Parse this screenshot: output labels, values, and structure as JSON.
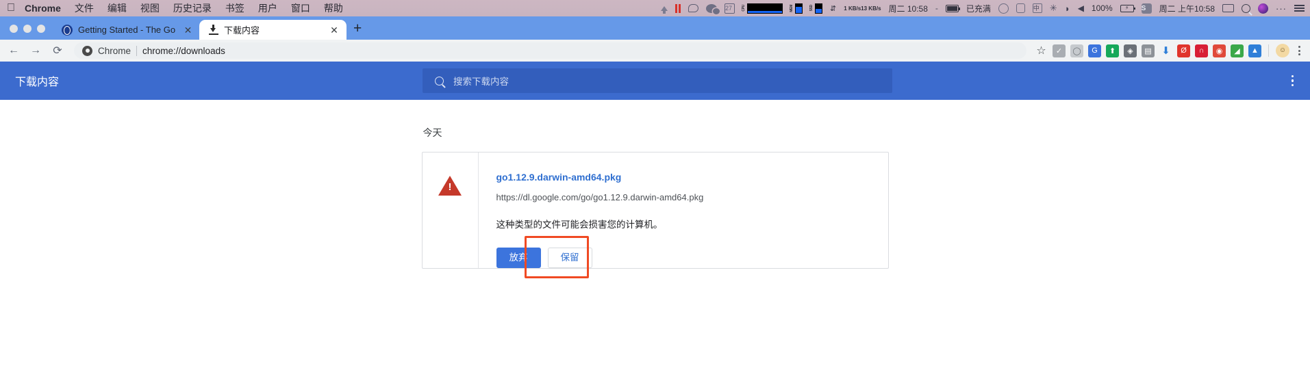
{
  "menubar": {
    "apple_icon": "apple-logo-icon",
    "items": [
      {
        "label": "Chrome",
        "bold": true
      },
      {
        "label": "文件",
        "bold": false
      },
      {
        "label": "编辑",
        "bold": false
      },
      {
        "label": "视图",
        "bold": false
      },
      {
        "label": "历史记录",
        "bold": false
      },
      {
        "label": "书签",
        "bold": false
      },
      {
        "label": "用户",
        "bold": false
      },
      {
        "label": "窗口",
        "bold": false
      },
      {
        "label": "帮助",
        "bold": false
      }
    ],
    "status": {
      "calendar_day": "27",
      "cpu_label": "CPU",
      "mem_label": "MEM",
      "disk_label": "SSD",
      "net_up": "1 KB/s",
      "net_down": "13 KB/s",
      "clock_left": "周二 10:58",
      "dash": "-",
      "battery_state": "已充满",
      "ime_char": "中",
      "battery_percent": "100%",
      "sogou_char": "S",
      "clock_right": "周二 上午10:58",
      "dots": "···"
    }
  },
  "tabs": {
    "items": [
      {
        "title": "Getting Started - The Go Progr",
        "icon": "globe-icon",
        "active": false,
        "close": "✕"
      },
      {
        "title": "下载内容",
        "icon": "download-icon",
        "active": true,
        "close": "✕"
      }
    ],
    "new_tab_label": "+"
  },
  "toolbar": {
    "back": "←",
    "forward": "→",
    "reload": "⟳",
    "omnibox_label": "Chrome",
    "omnibox_url": "chrome://downloads",
    "star": "☆",
    "extensions": [
      {
        "name": "adblock-shield-icon",
        "glyph": "✓",
        "color": "#a9adb2"
      },
      {
        "name": "ghostery-icon",
        "glyph": "◯",
        "color": "#c6cace"
      },
      {
        "name": "google-translate-icon",
        "glyph": "G",
        "color": "#3c74dd"
      },
      {
        "name": "shopping-bag-icon",
        "glyph": "⬆",
        "color": "#16a85a"
      },
      {
        "name": "privacy-badger-icon",
        "glyph": "◈",
        "color": "#6b7077"
      },
      {
        "name": "screenshot-icon",
        "glyph": "▤",
        "color": "#8d9298"
      },
      {
        "name": "download-helper-icon",
        "glyph": "⬇",
        "color": "#2f7fd8"
      },
      {
        "name": "opera-vpn-icon",
        "glyph": "Ø",
        "color": "#e0352c"
      },
      {
        "name": "pocket-icon",
        "glyph": "∩",
        "color": "#d81f36"
      },
      {
        "name": "adguard-icon",
        "glyph": "◉",
        "color": "#e0493a"
      },
      {
        "name": "evernote-icon",
        "glyph": "◢",
        "color": "#3aa84a"
      },
      {
        "name": "pushbullet-icon",
        "glyph": "▲",
        "color": "#2f7fd8"
      }
    ],
    "avatar_glyph": "☺",
    "menu": "kebab-menu-icon"
  },
  "downloads_page": {
    "title": "下载内容",
    "search_placeholder": "搜索下载内容",
    "search_value": "",
    "menu": "more-options-icon",
    "day_label": "今天",
    "item": {
      "warning_icon": "warning-triangle-icon",
      "file_name": "go1.12.9.darwin-amd64.pkg",
      "file_url": "https://dl.google.com/go/go1.12.9.darwin-amd64.pkg",
      "warning_text": "这种类型的文件可能会损害您的计算机。",
      "discard_label": "放弃",
      "keep_label": "保留"
    }
  },
  "annotation": {
    "highlight_color": "#f04a23",
    "highlight_target": "保留"
  }
}
